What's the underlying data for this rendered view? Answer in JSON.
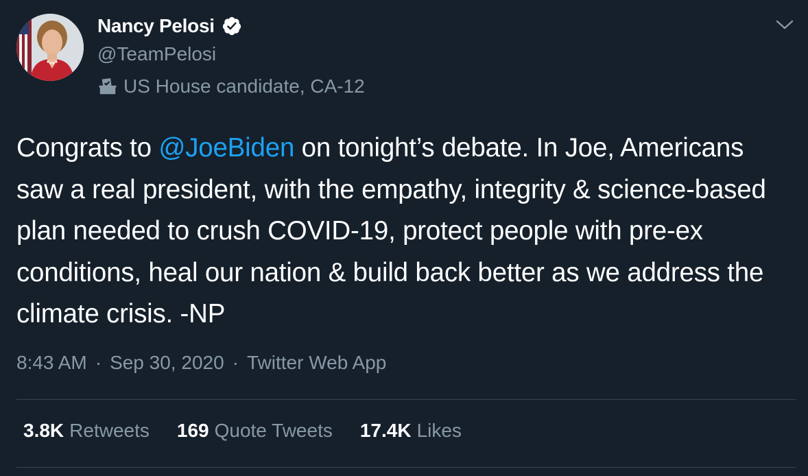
{
  "author": {
    "display_name": "Nancy Pelosi",
    "handle": "@TeamPelosi",
    "label": "US House candidate, CA-12",
    "label_icon": "ballot-box-icon",
    "verified_icon": "verified-badge-icon"
  },
  "tweet": {
    "text_before": "Congrats to ",
    "mention": "@JoeBiden",
    "text_after": " on tonight’s debate. In Joe, Americans saw a real president, with the empathy, integrity & science-based plan needed to crush COVID-19, protect people with pre-ex conditions, heal our nation & build back better as we address the climate crisis. -NP"
  },
  "meta": {
    "time": "8:43 AM",
    "sep1": "·",
    "date": "Sep 30, 2020",
    "sep2": "·",
    "source": "Twitter Web App"
  },
  "stats": [
    {
      "count": "3.8K",
      "label": "Retweets"
    },
    {
      "count": "169",
      "label": "Quote Tweets"
    },
    {
      "count": "17.4K",
      "label": "Likes"
    }
  ],
  "colors": {
    "background": "#15202b",
    "accent": "#1da1f2",
    "secondary_text": "#8899a6",
    "divider": "#38444d"
  }
}
